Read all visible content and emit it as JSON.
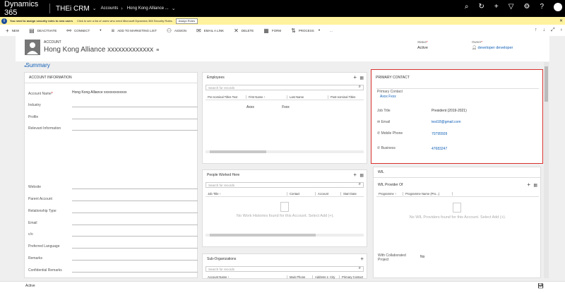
{
  "topnav": {
    "brand": "Dynamics 365",
    "app": "THEi CRM",
    "breadcrumb": [
      "Accounts",
      "Hong Kong Alliance ..."
    ]
  },
  "notice": {
    "bold": "You need to assign security roles to new users",
    "text": "Click to see a list of users who need Microsoft Dynamics 365 Security Roles.",
    "button": "Assign Roles"
  },
  "commands": [
    "NEW",
    "DEACTIVATE",
    "CONNECT",
    "ADD TO MARKETING LIST",
    "ASSIGN",
    "EMAIL A LINK",
    "DELETE",
    "FORM",
    "PROCESS",
    "..."
  ],
  "header": {
    "kicker": "ACCOUNT",
    "title": "Hong Kong Alliance xxxxxxxxxxxxx",
    "status_label": "Status",
    "status_value": "Active",
    "owner_label": "Owner",
    "owner_value": "developer developer"
  },
  "summary_label": "Summary",
  "account_info": {
    "title": "ACCOUNT INFORMATION",
    "fields": [
      {
        "label": "Account Name",
        "value": "Hong Kong Alliance xxxxxxxxxxxxx",
        "required": true
      },
      {
        "label": "Industry",
        "value": ""
      },
      {
        "label": "Profile",
        "value": ""
      },
      {
        "label": "Relevant Information",
        "value": ""
      },
      {
        "label": "Website",
        "value": ""
      },
      {
        "label": "Parent Account",
        "value": ""
      },
      {
        "label": "Relationship Type",
        "value": ""
      },
      {
        "label": "Email",
        "value": ""
      },
      {
        "label": "c/o",
        "value": ""
      },
      {
        "label": "Preferred Language",
        "value": ""
      },
      {
        "label": "Remarks",
        "value": ""
      },
      {
        "label": "Confidential Remarks",
        "value": ""
      }
    ]
  },
  "employees": {
    "title": "Employees",
    "search_placeholder": "Search for records",
    "columns": [
      "Pre-nominal Titles Text",
      "First Name ↑",
      "Last Name",
      "Post-nominal Titles"
    ],
    "row": {
      "first": "Axxx",
      "last": "Fxxx"
    }
  },
  "people_worked": {
    "title": "People Worked Here",
    "search_placeholder": "Search for records",
    "columns": [
      "Job Title ↑",
      "Contact",
      "Account",
      "Start Date"
    ],
    "empty": "No Work Histories found for this Account. Select Add (+)."
  },
  "sub_orgs": {
    "title": "Sub-Organizations",
    "search_placeholder": "Search for records",
    "columns": [
      "Account Name ↑",
      "Main Phone",
      "Address 1: City",
      "Primary Contact"
    ]
  },
  "primary_contact": {
    "title": "PRIMARY CONTACT",
    "contact_label": "Primary Contact",
    "contact_name": "Axxx Fxxx",
    "job_title_label": "Job Title",
    "job_title": "President (2019-2021)",
    "email_label": "Email",
    "email": "test18@gmail.com",
    "mobile_label": "Mobile Phone",
    "mobile": "70795509",
    "business_label": "Business",
    "business": "47683247"
  },
  "wil": {
    "title": "WIL",
    "provider_title": "WIL Provider Of",
    "columns": [
      "Programme ↑",
      "Programme Name (Pro...)"
    ],
    "empty": "No WIL Providers found for this Account. Select Add (+).",
    "collab_label": "With Collaborated Project",
    "collab_value": "No"
  },
  "statusbar": "Active",
  "colors": {
    "accent": "#1160b7",
    "highlight": "#d9302c",
    "notice": "#fff29e"
  }
}
